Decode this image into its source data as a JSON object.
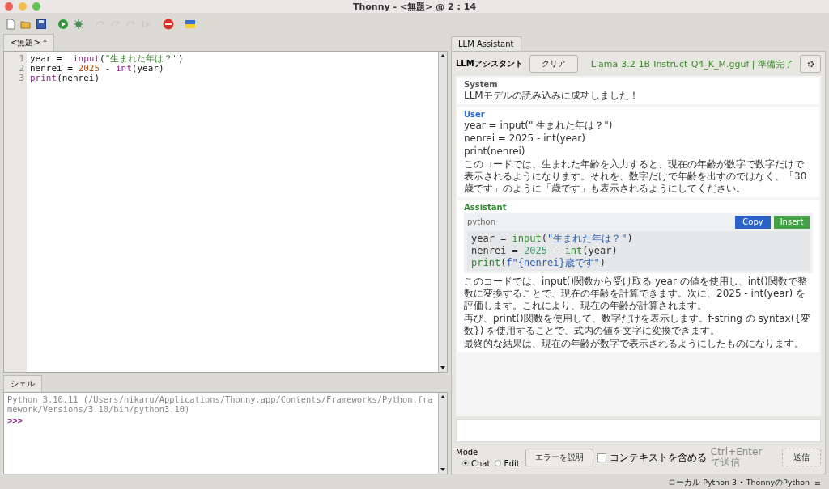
{
  "window": {
    "title": "Thonny  -  <無題>  @  2 : 14"
  },
  "toolbar": [
    {
      "kind": "new",
      "disabled": false
    },
    {
      "kind": "open",
      "disabled": false
    },
    {
      "kind": "save",
      "disabled": false
    },
    {
      "kind": "run",
      "disabled": false
    },
    {
      "kind": "debug",
      "disabled": false
    },
    {
      "kind": "step-over",
      "disabled": true
    },
    {
      "kind": "step-into",
      "disabled": true
    },
    {
      "kind": "step-out",
      "disabled": true
    },
    {
      "kind": "resume",
      "disabled": true
    },
    {
      "kind": "stop",
      "disabled": false
    },
    {
      "kind": "flag",
      "disabled": false
    }
  ],
  "editor": {
    "tab": {
      "label": "<無題> *",
      "selected": true
    },
    "lines": [
      {
        "number": "1",
        "tokens": [
          {
            "kind": "plain",
            "text": "year =  "
          },
          {
            "kind": "builtin",
            "text": "input"
          },
          {
            "kind": "plain",
            "text": "("
          },
          {
            "kind": "string",
            "text": "\"生まれた年は？\""
          },
          {
            "kind": "plain",
            "text": ")"
          }
        ]
      },
      {
        "number": "2",
        "tokens": [
          {
            "kind": "plain",
            "text": "nenrei = "
          },
          {
            "kind": "number",
            "text": "2025"
          },
          {
            "kind": "plain",
            "text": " - "
          },
          {
            "kind": "builtin",
            "text": "int"
          },
          {
            "kind": "plain",
            "text": "(year)"
          }
        ]
      },
      {
        "number": "3",
        "tokens": [
          {
            "kind": "builtin",
            "text": "print"
          },
          {
            "kind": "plain",
            "text": "(nenrei)"
          }
        ]
      }
    ]
  },
  "shell": {
    "tab": {
      "label": "シェル",
      "selected": true
    },
    "output": "Python 3.10.11 (/Users/hikaru/Applications/Thonny.app/Contents/Frameworks/Python.framework/Versions/3.10/bin/python3.10)",
    "prompt": ">>>"
  },
  "assistant": {
    "tab": {
      "label": "LLM Assistant",
      "selected": true
    },
    "header_label": "LLMアシスタント",
    "clear_button": "クリア",
    "model_status": "Llama-3.2-1B-Instruct-Q4_K_M.gguf | 準備完了",
    "messages": [
      {
        "kind": "system",
        "label": "System",
        "paragraphs": [
          "LLMモデルの読み込みに成功しました！"
        ]
      },
      {
        "kind": "user",
        "label": "User",
        "paragraphs": [
          "year = input(\" 生まれた年は？\")",
          "nenrei = 2025 - int(year)",
          "print(nenrei)",
          "このコードでは、生まれた年齢を入力すると、現在の年齢が数字で数字だけで表示されるようになります。それを、数字だけで年齢を出すのではなく、「30歳です」のように「歳です」も表示されるようにしてください。"
        ]
      },
      {
        "kind": "assistant",
        "label": "Assistant",
        "code": {
          "language": "python",
          "buttons": [
            "Copy",
            "Insert"
          ],
          "lines": [
            [
              {
                "kind": "plain",
                "text": "year = "
              },
              {
                "kind": "builtin",
                "text": "input"
              },
              {
                "kind": "plain",
                "text": "("
              },
              {
                "kind": "string",
                "text": "\"生まれた年は？\""
              },
              {
                "kind": "plain",
                "text": ")"
              }
            ],
            [
              {
                "kind": "plain",
                "text": "nenrei = "
              },
              {
                "kind": "number",
                "text": "2025"
              },
              {
                "kind": "plain",
                "text": " - "
              },
              {
                "kind": "builtin",
                "text": "int"
              },
              {
                "kind": "plain",
                "text": "(year)"
              }
            ],
            [
              {
                "kind": "builtin",
                "text": "print"
              },
              {
                "kind": "plain",
                "text": "("
              },
              {
                "kind": "string",
                "text": "f\"{nenrei}歳です\""
              },
              {
                "kind": "plain",
                "text": ")"
              }
            ]
          ]
        },
        "paragraphs": [
          "このコードでは、input()関数から受け取る year の値を使用し、int()関数で整数に変換することで、現在の年齢を計算できます。次に、2025 - int(year) を評価します。これにより、現在の年齢が計算されます。",
          "再び、print()関数を使用して、数字だけを表示します。f-string の syntax({変数}) を使用することで、式内の値を文字に変換できます。",
          "最終的な結果は、現在の年齢が数字で表示されるようにしたものになります。"
        ]
      }
    ],
    "mode": {
      "label": "Mode",
      "options": [
        {
          "label": "Chat",
          "selected": true
        },
        {
          "label": "Edit",
          "selected": false
        }
      ]
    },
    "explain_button": "エラーを説明",
    "context_checkbox": {
      "label": "コンテキストを含める",
      "checked": false
    },
    "send_hint": "Ctrl+Enterで送信",
    "send_button": "送信"
  },
  "status_bar": {
    "text": "ローカル Python 3  •  ThonnyのPython",
    "menu": "≡"
  }
}
